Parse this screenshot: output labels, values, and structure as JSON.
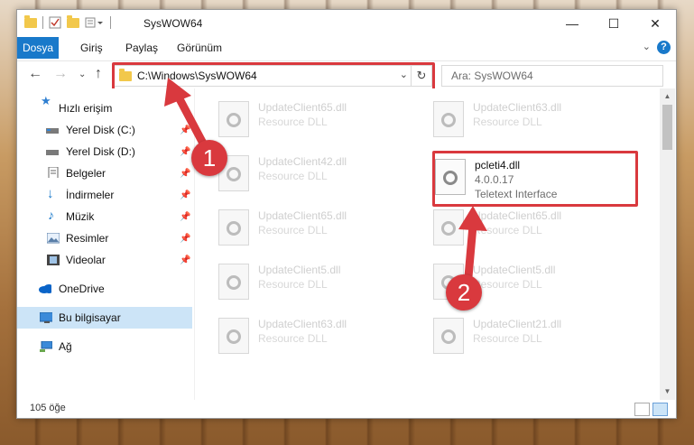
{
  "window": {
    "title": "SysWOW64"
  },
  "ribbon": {
    "tabs": [
      "Dosya",
      "Giriş",
      "Paylaş",
      "Görünüm"
    ]
  },
  "address": {
    "path": "C:\\Windows\\SysWOW64"
  },
  "search": {
    "placeholder": "Ara: SysWOW64"
  },
  "sidebar": {
    "items": [
      {
        "label": "Hızlı erişim",
        "icon": "star-icon"
      },
      {
        "label": "Yerel Disk (C:)",
        "icon": "drive-icon"
      },
      {
        "label": "Yerel Disk (D:)",
        "icon": "drive-icon"
      },
      {
        "label": "Belgeler",
        "icon": "documents-icon"
      },
      {
        "label": "İndirmeler",
        "icon": "download-icon"
      },
      {
        "label": "Müzik",
        "icon": "music-icon"
      },
      {
        "label": "Resimler",
        "icon": "pictures-icon"
      },
      {
        "label": "Videolar",
        "icon": "videos-icon"
      },
      {
        "label": "OneDrive",
        "icon": "onedrive-icon"
      },
      {
        "label": "Bu bilgisayar",
        "icon": "computer-icon"
      },
      {
        "label": "Ağ",
        "icon": "network-icon"
      }
    ]
  },
  "files": {
    "left": [
      {
        "name": "UpdateClient65.dll",
        "desc": "Resource DLL"
      },
      {
        "name": "UpdateClient42.dll",
        "desc": "Resource DLL"
      },
      {
        "name": "UpdateClient65.dll",
        "desc": "Resource DLL"
      },
      {
        "name": "UpdateClient5.dll",
        "desc": "Resource DLL"
      },
      {
        "name": "UpdateClient63.dll",
        "desc": "Resource DLL"
      }
    ],
    "right": [
      {
        "name": "UpdateClient63.dll",
        "desc": "Resource DLL"
      },
      {
        "name": "UpdateClient65.dll",
        "desc": "Resource DLL"
      },
      {
        "name": "UpdateClient5.dll",
        "desc": "Resource DLL"
      },
      {
        "name": "UpdateClient21.dll",
        "desc": "Resource DLL"
      }
    ],
    "highlighted": {
      "name": "pcleti4.dll",
      "version": "4.0.0.17",
      "type": "Teletext Interface"
    }
  },
  "status": {
    "count": "105 öğe"
  },
  "annotations": {
    "badge1": "1",
    "badge2": "2",
    "color": "#d9393e"
  }
}
